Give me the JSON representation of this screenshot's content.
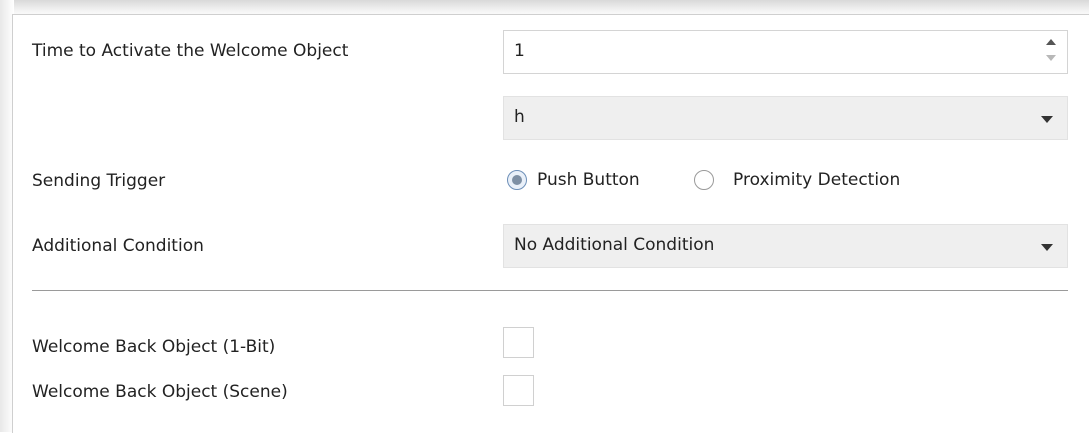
{
  "rows": {
    "time_label": "Time to Activate the Welcome Object",
    "time_value": "1",
    "unit_value": "h",
    "trigger_label": "Sending Trigger",
    "trigger_options": [
      "Push Button",
      "Proximity Detection"
    ],
    "trigger_selected": "Push Button",
    "condition_label": "Additional Condition",
    "condition_value": "No Additional Condition",
    "welcome_1bit_label": "Welcome Back Object (1-Bit)",
    "welcome_1bit_checked": false,
    "welcome_scene_label": "Welcome Back Object (Scene)",
    "welcome_scene_checked": false
  },
  "icons": [
    "spin-up-icon",
    "spin-down-icon",
    "dropdown-caret-icon"
  ]
}
